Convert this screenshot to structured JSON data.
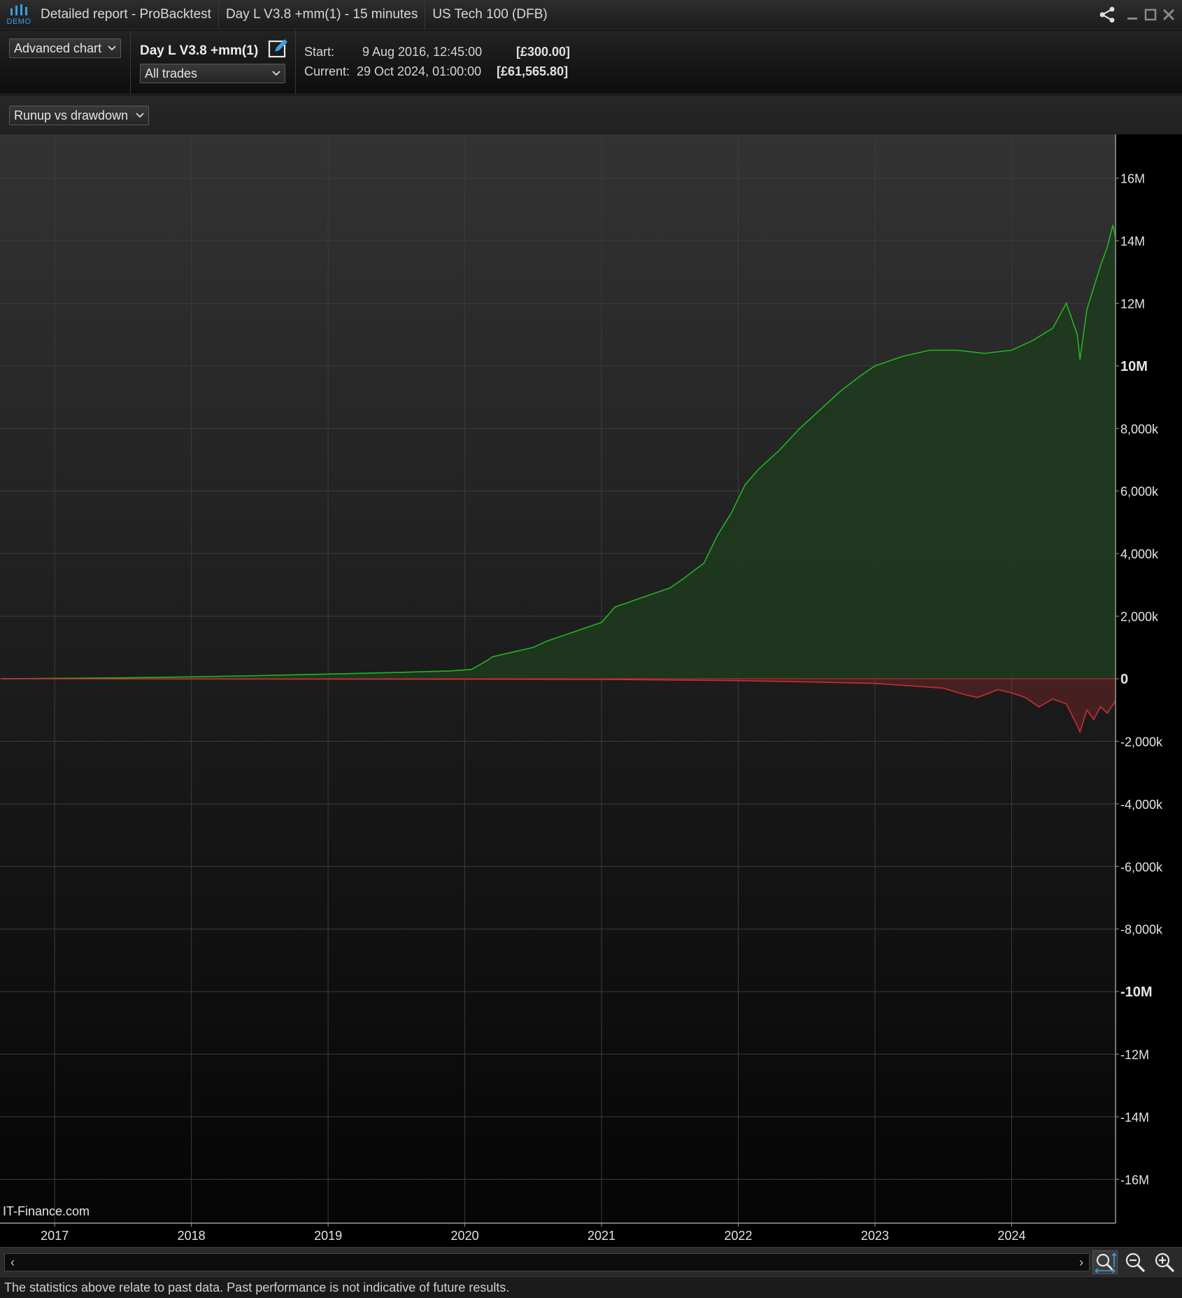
{
  "window": {
    "title": "Detailed report - ProBacktest",
    "strategy_period": "Day L V3.8 +mm(1) - 15 minutes",
    "instrument": "US Tech 100 (DFB)",
    "demo_badge": "DEMO",
    "icons": [
      "share-icon",
      "minimize-icon",
      "maximize-icon",
      "close-icon"
    ]
  },
  "header": {
    "view_select": "Advanced chart",
    "strategy_name": "Day L V3.8 +mm(1)",
    "trades_select": "All trades",
    "start_label": "Start:",
    "start_date": "9 Aug 2016, 12:45:00",
    "start_value": "[£300.00]",
    "current_label": "Current:",
    "current_date": "29 Oct 2024, 01:00:00",
    "current_value": "[£61,565.80]"
  },
  "chart_selector": "Runup vs drawdown",
  "watermark": "IT-Finance.com",
  "chart_data": {
    "type": "area",
    "x_ticks": [
      "2017",
      "2018",
      "2019",
      "2020",
      "2021",
      "2022",
      "2023",
      "2024"
    ],
    "y_ticks": [
      {
        "label": "16M",
        "value": 16000000,
        "bold": false
      },
      {
        "label": "14M",
        "value": 14000000,
        "bold": false
      },
      {
        "label": "12M",
        "value": 12000000,
        "bold": false
      },
      {
        "label": "10M",
        "value": 10000000,
        "bold": true
      },
      {
        "label": "8,000k",
        "value": 8000000,
        "bold": false
      },
      {
        "label": "6,000k",
        "value": 6000000,
        "bold": false
      },
      {
        "label": "4,000k",
        "value": 4000000,
        "bold": false
      },
      {
        "label": "2,000k",
        "value": 2000000,
        "bold": false
      },
      {
        "label": "0",
        "value": 0,
        "bold": true
      },
      {
        "label": "-2,000k",
        "value": -2000000,
        "bold": false
      },
      {
        "label": "-4,000k",
        "value": -4000000,
        "bold": false
      },
      {
        "label": "-6,000k",
        "value": -6000000,
        "bold": false
      },
      {
        "label": "-8,000k",
        "value": -8000000,
        "bold": false
      },
      {
        "label": "-10M",
        "value": -10000000,
        "bold": true
      },
      {
        "label": "-12M",
        "value": -12000000,
        "bold": false
      },
      {
        "label": "-14M",
        "value": -14000000,
        "bold": false
      },
      {
        "label": "-16M",
        "value": -16000000,
        "bold": false
      }
    ],
    "ylim": [
      -17400000,
      17400000
    ],
    "xlim": [
      2016.6,
      2024.76
    ],
    "grid": true,
    "series": [
      {
        "color": "#21b521",
        "fill": "#1f3a1f",
        "x": [
          2016.61,
          2017.5,
          2018.0,
          2018.5,
          2019.0,
          2019.5,
          2019.9,
          2020.05,
          2020.17,
          2020.2,
          2020.3,
          2020.5,
          2020.6,
          2020.8,
          2021.0,
          2021.1,
          2021.17,
          2021.3,
          2021.5,
          2021.6,
          2021.75,
          2021.85,
          2021.95,
          2022.05,
          2022.15,
          2022.3,
          2022.45,
          2022.6,
          2022.75,
          2022.9,
          2023.0,
          2023.2,
          2023.4,
          2023.6,
          2023.8,
          2024.0,
          2024.15,
          2024.3,
          2024.4,
          2024.48,
          2024.5,
          2024.55,
          2024.6,
          2024.65,
          2024.7,
          2024.74,
          2024.76
        ],
        "values": [
          300,
          30000,
          60000,
          100000,
          150000,
          200000,
          250000,
          300000,
          600000,
          700000,
          800000,
          1000000,
          1200000,
          1500000,
          1800000,
          2300000,
          2400000,
          2600000,
          2900000,
          3200000,
          3700000,
          4600000,
          5300000,
          6200000,
          6700000,
          7300000,
          8000000,
          8600000,
          9200000,
          9700000,
          10000000,
          10300000,
          10500000,
          10500000,
          10400000,
          10500000,
          10800000,
          11200000,
          12000000,
          11000000,
          10200000,
          11800000,
          12500000,
          13200000,
          13800000,
          14500000,
          14100000
        ]
      },
      {
        "color": "#c83030",
        "x": [
          2016.61,
          2021.0,
          2022.0,
          2022.5,
          2023.0,
          2023.5,
          2023.65,
          2023.75,
          2023.9,
          2024.0,
          2024.1,
          2024.2,
          2024.3,
          2024.4,
          2024.48,
          2024.5,
          2024.55,
          2024.6,
          2024.65,
          2024.7,
          2024.76
        ],
        "values": [
          0,
          -20000,
          -60000,
          -100000,
          -150000,
          -300000,
          -500000,
          -600000,
          -350000,
          -450000,
          -600000,
          -900000,
          -650000,
          -800000,
          -1500000,
          -1700000,
          -1000000,
          -1300000,
          -900000,
          -1100000,
          -700000
        ]
      }
    ]
  },
  "footer": {
    "disclaimer": "The statistics above relate to past data. Past performance is not indicative of future results."
  }
}
